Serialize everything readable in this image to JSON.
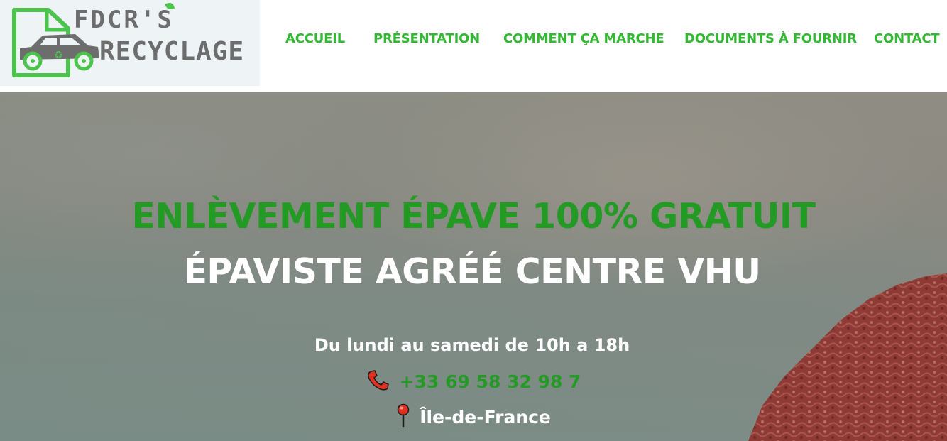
{
  "logo": {
    "line1": "FDCR'S",
    "line2": "RECYCLAGE",
    "brand_green": "#4cc34c",
    "brand_gray": "#6d6d6d"
  },
  "nav": {
    "items": [
      {
        "label": "ACCUEIL"
      },
      {
        "label": "PRÉSENTATION"
      },
      {
        "label": "COMMENT ÇA MARCHE"
      },
      {
        "label": "DOCUMENTS À FOURNIR"
      },
      {
        "label": "CONTACT"
      }
    ],
    "color": "#33b833"
  },
  "hero": {
    "title": "ENLÈVEMENT ÉPAVE 100% GRATUIT",
    "subtitle": "ÉPAVISTE AGRÉÉ CENTRE VHU",
    "hours": "Du lundi au samedi de 10h a 18h",
    "phone": "+33 69 58 32 98 7",
    "location": "Île-de-France",
    "phone_icon": "phone-icon",
    "location_icon": "map-pin-icon",
    "title_color": "#239a23"
  }
}
